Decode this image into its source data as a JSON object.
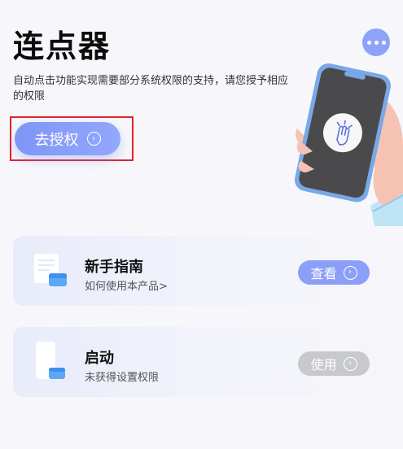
{
  "header": {
    "title": "连点器",
    "description": "自动点击功能实现需要部分系统权限的支持，请您授予相应的权限",
    "authorize_label": "去授权"
  },
  "icons": {
    "more": "more-dots-icon",
    "arrow": "circle-arrow-right-icon",
    "illustration": "hand-holding-phone-tap-icon"
  },
  "cards": [
    {
      "title": "新手指南",
      "subtitle": "如何使用本产品>",
      "button": "查看"
    },
    {
      "title": "启动",
      "subtitle": "未获得设置权限",
      "button": "使用"
    }
  ],
  "colors": {
    "accent": "#8c9ff8",
    "disabled": "#c8c9cd",
    "highlight": "#e2222a"
  }
}
